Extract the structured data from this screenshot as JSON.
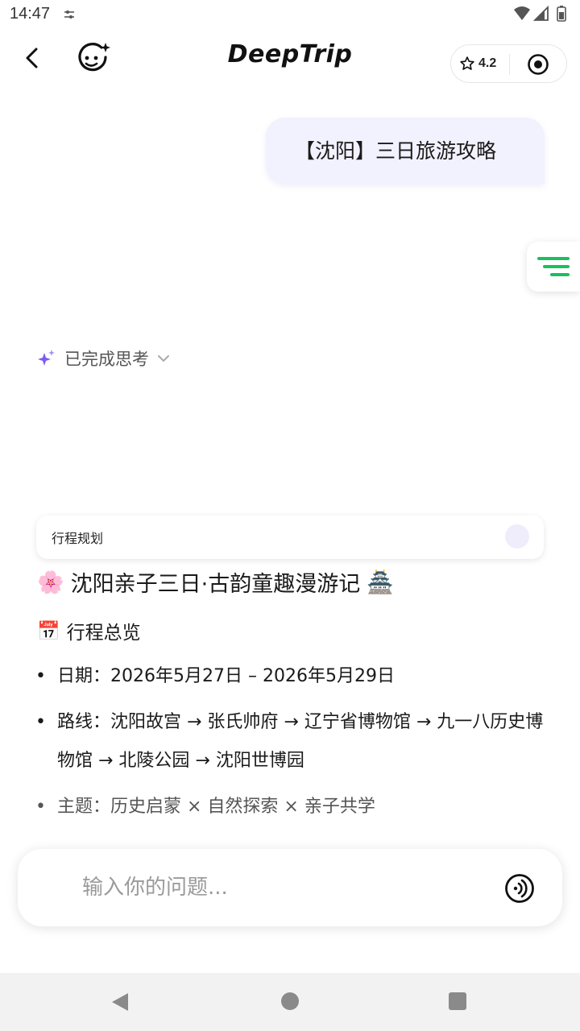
{
  "status_bar": {
    "time": "14:47"
  },
  "header": {
    "brand": "DeepTrip",
    "rating": "4.2"
  },
  "conversation": {
    "user_message": "【沈阳】三日旅游攻略",
    "thinking_status": "已完成思考"
  },
  "plan_card": {
    "label": "行程规划"
  },
  "itinerary": {
    "title": "沈阳亲子三日·古韵童趣漫游记",
    "title_emoji_left": "🌸",
    "title_emoji_right": "🏯",
    "overview_heading": "行程总览",
    "overview_emoji": "📅",
    "bullets": [
      "日期：2026年5月27日 – 2026年5月29日",
      "路线：沈阳故宫 → 张氏帅府 → 辽宁省博物馆 → 九一八历史博物馆 → 北陵公园 → 沈阳世博园",
      "主题：历史启蒙 × 自然探索 × 亲子共学"
    ]
  },
  "input": {
    "placeholder": "输入你的问题..."
  },
  "colors": {
    "accent_green": "#18c060",
    "bubble_bg": "#f2f1fe",
    "sparkle_purple": "#7b5cf0"
  },
  "icons": {
    "back": "back-arrow-icon",
    "bot": "bot-face-icon",
    "star": "star-icon",
    "record": "record-icon",
    "menu": "menu-lines-icon",
    "sparkle": "sparkle-icon",
    "chevron": "chevron-down-icon",
    "voice": "voice-icon"
  }
}
